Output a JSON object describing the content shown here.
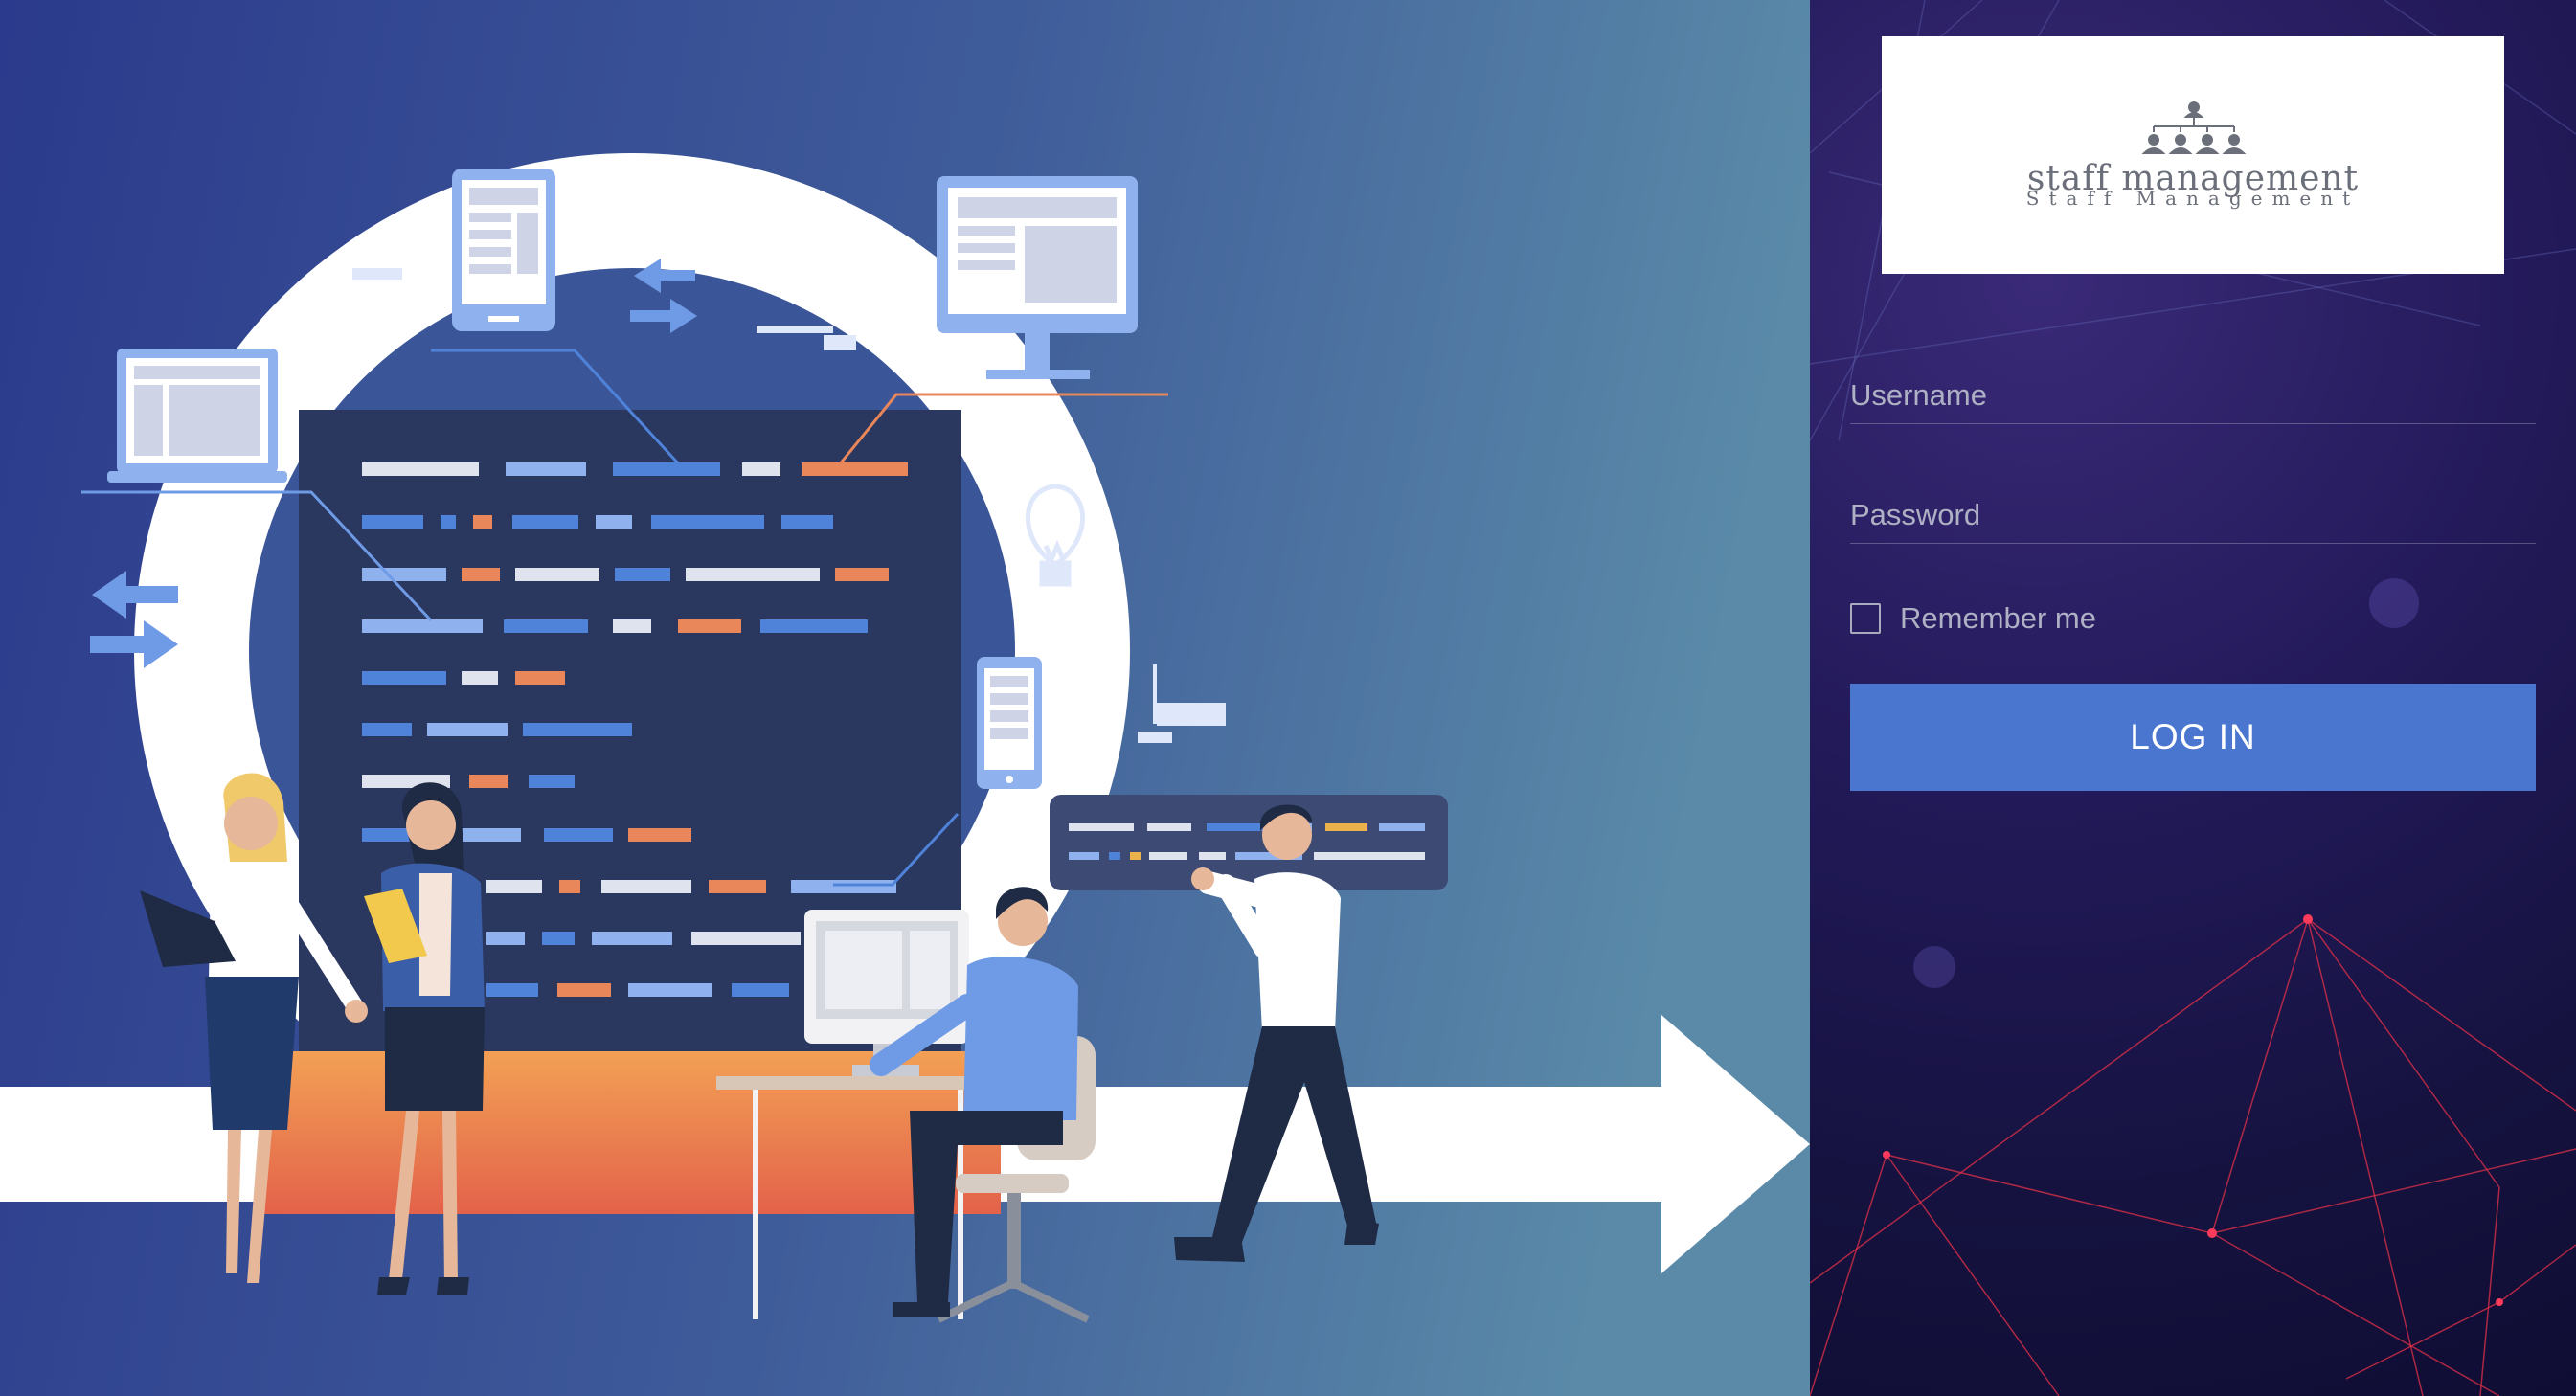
{
  "logo": {
    "title": "staff management",
    "subtitle": "Staff Management"
  },
  "login": {
    "username_placeholder": "Username",
    "username_value": "",
    "password_placeholder": "Password",
    "password_value": "",
    "remember_label": "Remember me",
    "remember_checked": false,
    "login_button_label": "LOG IN"
  },
  "colors": {
    "hero_gradient_left": "#2b3a8c",
    "hero_gradient_right": "#5a8aa8",
    "panel_background": "#1c1650",
    "login_button": "#4a76d0",
    "network_line": "#e03048"
  },
  "icons": [
    "org-chart-icon",
    "laptop-icon",
    "tablet-icon",
    "monitor-icon",
    "lightbulb-icon",
    "smartphone-icon",
    "exchange-arrows-icon",
    "checkbox-icon"
  ]
}
